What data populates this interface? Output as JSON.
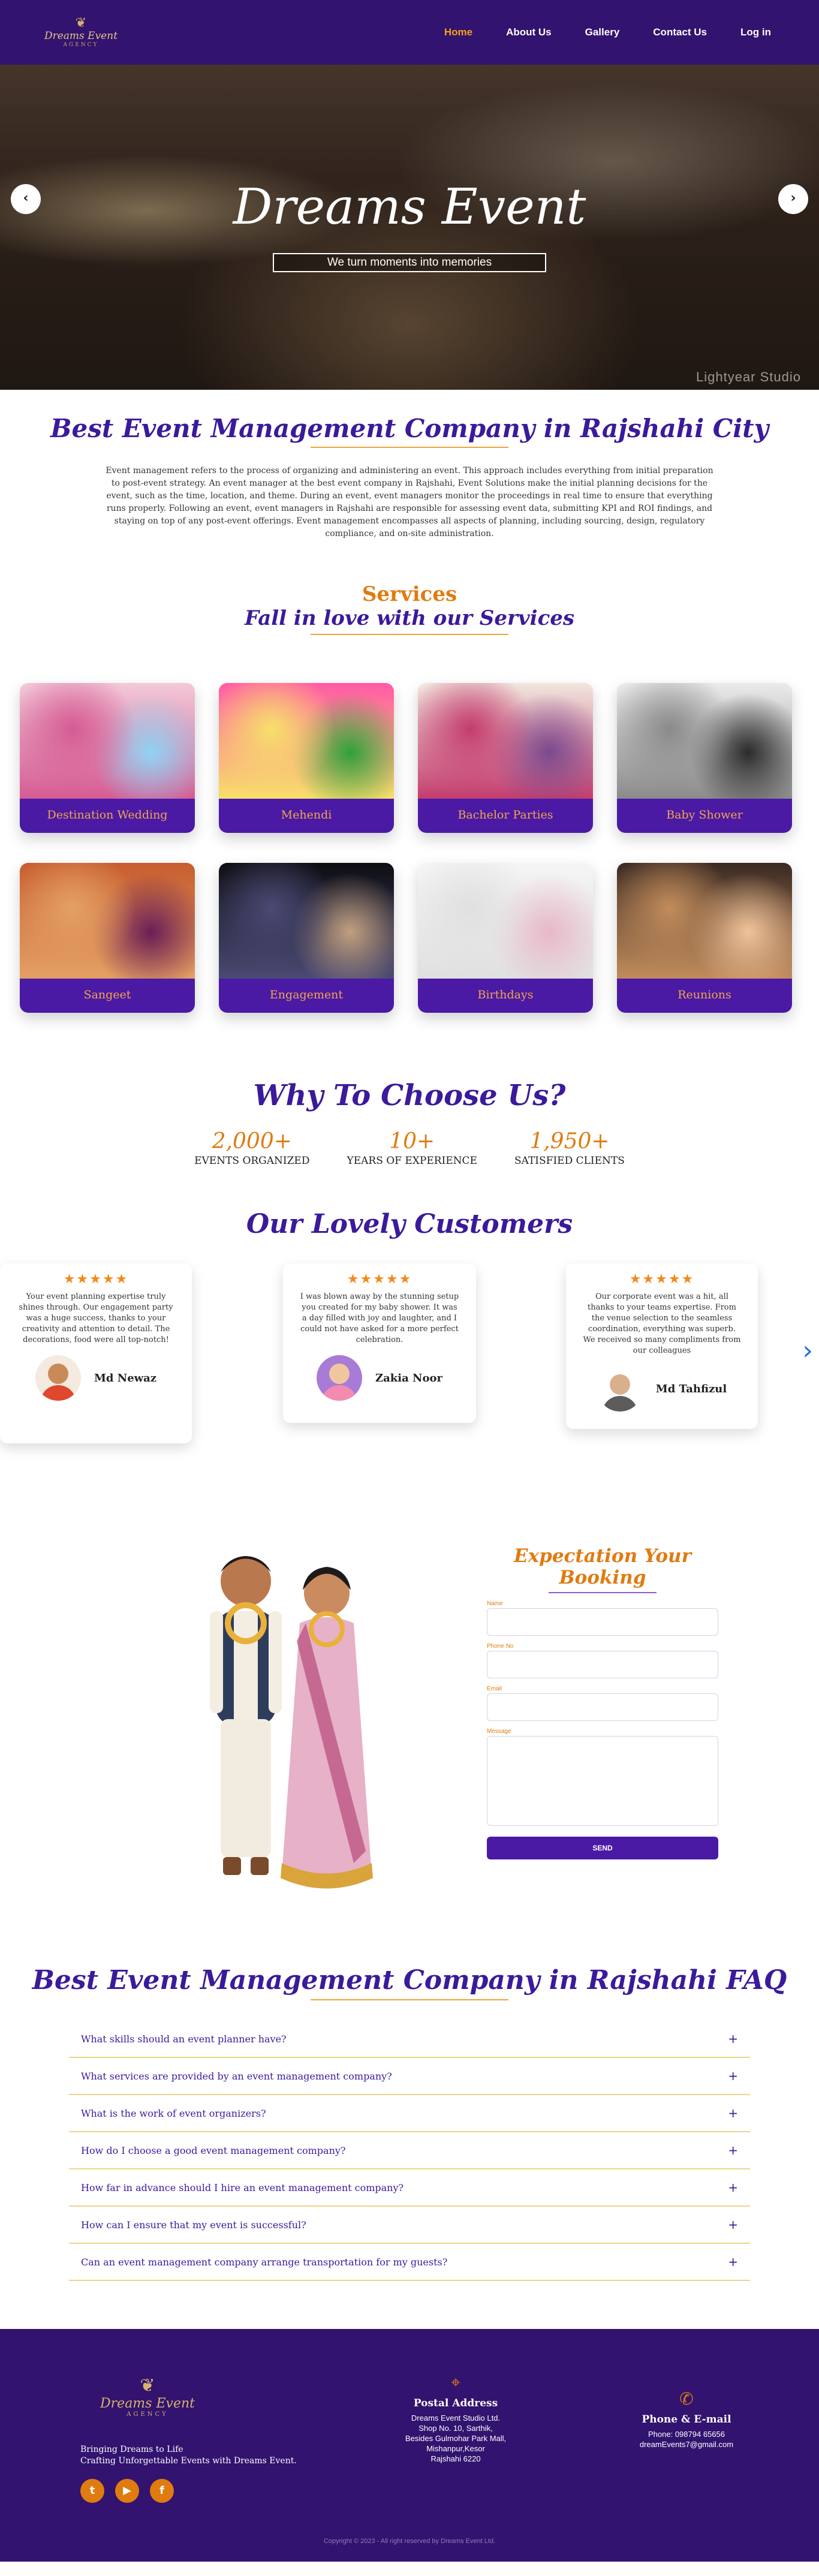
{
  "nav": {
    "logo": {
      "crest": "❦",
      "name": "Dreams Event",
      "sub": "AGENCY"
    },
    "items": [
      {
        "label": "Home",
        "active": true
      },
      {
        "label": "About Us",
        "active": false
      },
      {
        "label": "Gallery",
        "active": false
      },
      {
        "label": "Contact Us",
        "active": false
      },
      {
        "label": "Log in",
        "active": false
      }
    ]
  },
  "hero": {
    "title": "Dreams Event",
    "subtitle": "We turn moments into memories",
    "watermark": "Lightyear Studio",
    "prev": "‹",
    "next": "›"
  },
  "intro": {
    "title": "Best Event Management Company in Rajshahi City",
    "paragraph": "Event management refers to the process of organizing and administering an event. This approach includes everything from initial preparation to post-event strategy. An event manager at the best event company in Rajshahi, Event Solutions make the initial planning decisions for the event, such as the time, location, and theme. During an event, event managers monitor the proceedings in real time to ensure that everything runs properly. Following an event, event managers in Rajshahi are responsible for assessing event data, submitting KPI and ROI findings, and staying on top of any post-event offerings. Event management encompasses all aspects of planning, including sourcing, design, regulatory compliance, and on-site administration."
  },
  "services": {
    "heading": "Services",
    "subheading": "Fall in love with our Services",
    "items": [
      {
        "label": "Destination Wedding",
        "colors": [
          "#f2c9d8",
          "#d55b93",
          "#8fd3f4"
        ]
      },
      {
        "label": "Mehendi",
        "colors": [
          "#ff5aa6",
          "#f7e06a",
          "#30a13a"
        ]
      },
      {
        "label": "Bachelor Parties",
        "colors": [
          "#f1e7de",
          "#c43c6e",
          "#7b4a8e"
        ]
      },
      {
        "label": "Baby Shower",
        "colors": [
          "#ebebeb",
          "#8a8a8a",
          "#2b2b2b"
        ]
      },
      {
        "label": "Sangeet",
        "colors": [
          "#c75d2f",
          "#e4a064",
          "#6a1e57"
        ]
      },
      {
        "label": "Engagement",
        "colors": [
          "#0d0d12",
          "#4a4a74",
          "#c2a080"
        ]
      },
      {
        "label": "Birthdays",
        "colors": [
          "#f5f5f5",
          "#e0e0e0",
          "#e8b8c8"
        ]
      },
      {
        "label": "Reunions",
        "colors": [
          "#3a2a22",
          "#c28c5c",
          "#f0c39a"
        ]
      }
    ]
  },
  "why": {
    "title": "Why To Choose Us?",
    "stats": [
      {
        "number": "2,000+",
        "label": "EVENTS ORGANIZED"
      },
      {
        "number": "10+",
        "label": "YEARS OF EXPERIENCE"
      },
      {
        "number": "1,950+",
        "label": "SATISFIED CLIENTS"
      }
    ]
  },
  "customers": {
    "title": "Our Lovely Customers",
    "prev": "‹",
    "next": "›",
    "reviews": [
      {
        "stars": "★★★★★",
        "text": "Your event planning expertise truly shines through. Our engagement party was a huge success, thanks to your creativity and attention to detail. The decorations, food were all top-notch!",
        "name": "Md Newaz",
        "avatar_color": "#e0472f"
      },
      {
        "stars": "★★★★★",
        "text": "I was blown away by the stunning setup you created for my baby shower. It was a day filled with joy and laughter, and I could not have asked for a more perfect celebration.",
        "name": "Zakia Noor",
        "avatar_color": "#f48ab0"
      },
      {
        "stars": "★★★★★",
        "text": "Our corporate event was a hit, all thanks to your teams expertise. From the venue selection to the seamless coordination, everything was superb. We received so many compliments from our colleagues",
        "name": "Md Tahfizul",
        "avatar_color": "#9a9a9a"
      }
    ]
  },
  "booking": {
    "title": "Expectation Your Booking",
    "fields": {
      "name": "Name",
      "phone": "Phone No",
      "email": "Email",
      "message": "Message"
    },
    "send": "SEND"
  },
  "faq": {
    "title": "Best Event Management Company in Rajshahi FAQ",
    "items": [
      "What skills should an event planner have?",
      "What services are provided by an event management company?",
      "What is the work of event organizers?",
      "How do I choose a good event management company?",
      "How far in advance should I hire an event management company?",
      "How can I ensure that my event is successful?",
      "Can an event management company arrange transportation for my guests?"
    ],
    "toggle": "+"
  },
  "footer": {
    "logo": {
      "crest": "❦",
      "name": "Dreams Event",
      "sub": "AGENCY"
    },
    "tagline1": "Bringing Dreams to Life",
    "tagline2": "Crafting Unforgettable Events with Dreams Event.",
    "socials": [
      "t",
      "▶",
      "f"
    ],
    "address": {
      "icon": "⌖",
      "title": "Postal Address",
      "lines": [
        "Dreams Event Studio Ltd.",
        "Shop No. 10, Sarthik,",
        "Besides Gulmohar Park Mall,",
        "Mishanpur,Kesor",
        "Rajshahi 6220"
      ]
    },
    "contact": {
      "icon": "✆",
      "title": "Phone & E-mail",
      "phone": "Phone: 098794 65656",
      "email": "dreamEvents7@gmail.com"
    },
    "copyright": "Copyright © 2023 - All right reserved by Dreams Event Ltd."
  }
}
